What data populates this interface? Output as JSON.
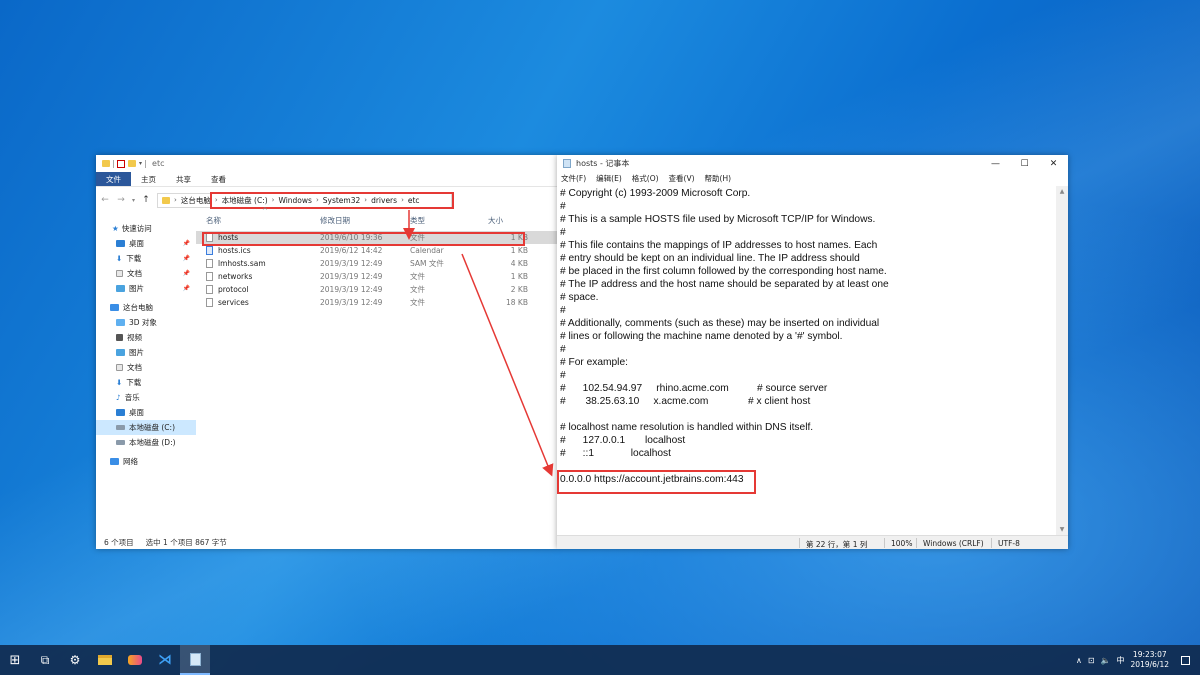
{
  "explorer": {
    "title": "etc",
    "ribbon_tabs": [
      "文件",
      "主页",
      "共享",
      "查看"
    ],
    "nav_back": "←",
    "nav_forward": "→",
    "nav_up": "↑",
    "address_root": "这台电脑",
    "address_path": [
      "本地磁盘 (C:)",
      "Windows",
      "System32",
      "drivers",
      "etc"
    ],
    "columns": {
      "name": "名称",
      "date": "修改日期",
      "type": "类型",
      "size": "大小"
    },
    "files": [
      {
        "name": "hosts",
        "date": "2019/6/10 19:36",
        "type": "文件",
        "size": "1 KB"
      },
      {
        "name": "hosts.ics",
        "date": "2019/6/12 14:42",
        "type": "Calendar",
        "size": "1 KB"
      },
      {
        "name": "lmhosts.sam",
        "date": "2019/3/19 12:49",
        "type": "SAM 文件",
        "size": "4 KB"
      },
      {
        "name": "networks",
        "date": "2019/3/19 12:49",
        "type": "文件",
        "size": "1 KB"
      },
      {
        "name": "protocol",
        "date": "2019/3/19 12:49",
        "type": "文件",
        "size": "2 KB"
      },
      {
        "name": "services",
        "date": "2019/3/19 12:49",
        "type": "文件",
        "size": "18 KB"
      }
    ],
    "nav_items": [
      {
        "label": "快速访问"
      },
      {
        "label": "桌面"
      },
      {
        "label": "下载"
      },
      {
        "label": "文档"
      },
      {
        "label": "图片"
      },
      {
        "label": "这台电脑"
      },
      {
        "label": "3D 对象"
      },
      {
        "label": "视频"
      },
      {
        "label": "图片"
      },
      {
        "label": "文档"
      },
      {
        "label": "下载"
      },
      {
        "label": "音乐"
      },
      {
        "label": "桌面"
      },
      {
        "label": "本地磁盘 (C:)"
      },
      {
        "label": "本地磁盘 (D:)"
      },
      {
        "label": "网络"
      }
    ],
    "status_count": "6 个项目",
    "status_selected": "选中 1 个项目 867 字节"
  },
  "notepad": {
    "title": "hosts - 记事本",
    "menu": [
      "文件(F)",
      "编辑(E)",
      "格式(O)",
      "查看(V)",
      "帮助(H)"
    ],
    "minimize": "—",
    "maximize": "☐",
    "close": "✕",
    "content": "# Copyright (c) 1993-2009 Microsoft Corp.\n#\n# This is a sample HOSTS file used by Microsoft TCP/IP for Windows.\n#\n# This file contains the mappings of IP addresses to host names. Each\n# entry should be kept on an individual line. The IP address should\n# be placed in the first column followed by the corresponding host name.\n# The IP address and the host name should be separated by at least one\n# space.\n#\n# Additionally, comments (such as these) may be inserted on individual\n# lines or following the machine name denoted by a '#' symbol.\n#\n# For example:\n#\n#      102.54.94.97     rhino.acme.com          # source server\n#       38.25.63.10     x.acme.com              # x client host\n\n# localhost name resolution is handled within DNS itself.\n#\t127.0.0.1       localhost\n#\t::1             localhost\n\n0.0.0.0 https://account.jetbrains.com:443",
    "status": {
      "position": "第 22 行，第 1 列",
      "zoom": "100%",
      "line_ending": "Windows (CRLF)",
      "encoding": "UTF-8"
    }
  },
  "taskbar": {
    "start": "⊞",
    "task_view": "⧉",
    "settings": "⚙",
    "clock_time": "19:23:07",
    "clock_date": "2019/6/12",
    "tray_ime": "中",
    "tray_chevron": "∧",
    "tray_network": "⊡",
    "tray_volume": "🔈"
  },
  "colors": {
    "highlight_red": "#e53935",
    "ribbon_file": "#2b579a",
    "selected": "#cce8ff"
  }
}
